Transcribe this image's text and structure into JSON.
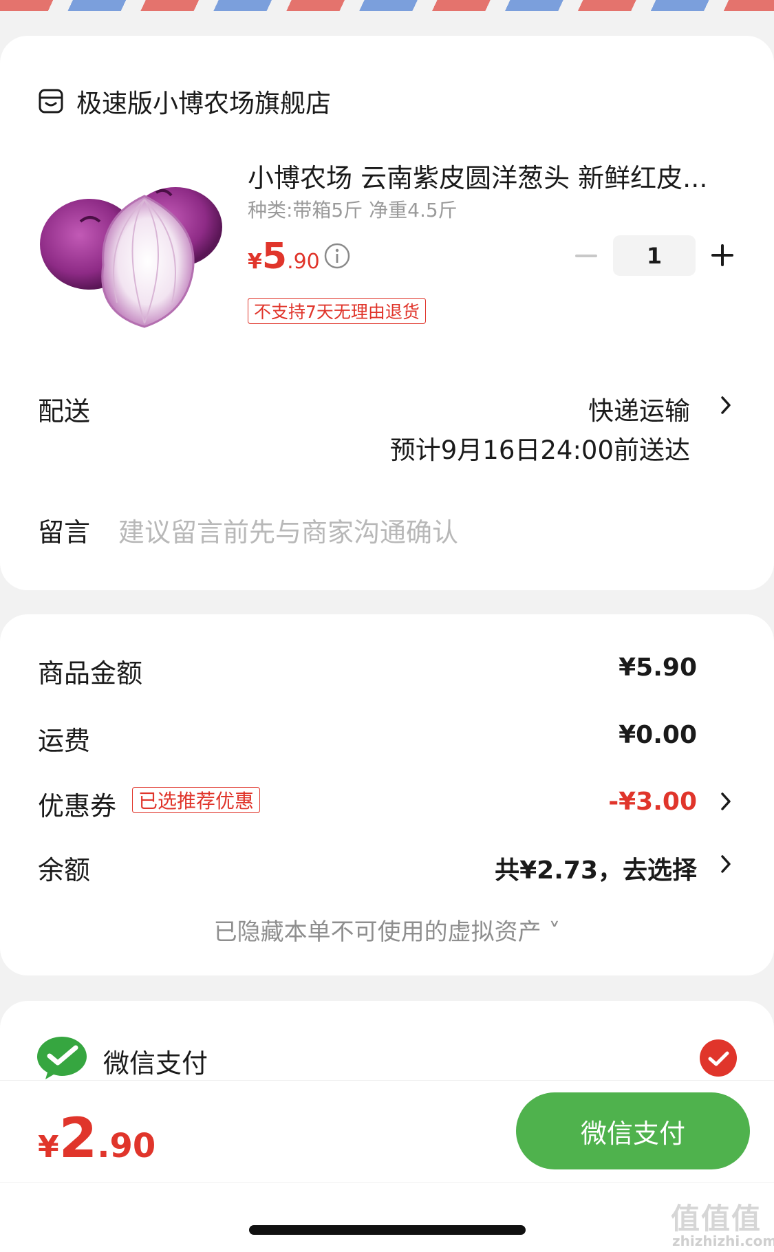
{
  "store": {
    "name": "极速版小博农场旗舰店",
    "icon": "store-icon"
  },
  "product": {
    "title": "小博农场 云南紫皮圆洋葱头 新鲜红皮...",
    "spec": "种类:带箱5斤 净重4.5斤",
    "price_symbol": "¥",
    "price_int": "5",
    "price_dec": ".90",
    "quantity": "1",
    "return_policy": "不支持7天无理由退货"
  },
  "delivery": {
    "label": "配送",
    "method": "快递运输",
    "eta": "预计9月16日24:00前送达"
  },
  "message": {
    "label": "留言",
    "placeholder": "建议留言前先与商家沟通确认"
  },
  "summary": {
    "goods_label": "商品金额",
    "goods_value": "¥5.90",
    "shipping_label": "运费",
    "shipping_value": "¥0.00",
    "coupon_label": "优惠券",
    "coupon_badge": "已选推荐优惠",
    "coupon_value": "-¥3.00",
    "balance_label": "余额",
    "balance_value": "共¥2.73，去选择",
    "hidden_assets": "已隐藏本单不可使用的虚拟资产 ˅"
  },
  "payment": {
    "method_label": "微信支付",
    "selected": true
  },
  "footer": {
    "total_symbol": "¥",
    "total_int": "2",
    "total_dec": ".90",
    "pay_button": "微信支付"
  },
  "watermark": {
    "text": "值值值",
    "sub": "zhizhizhi.com"
  },
  "colors": {
    "accent_red": "#e0352b",
    "wechat_green": "#4fb24d",
    "background": "#f2f2f2"
  }
}
